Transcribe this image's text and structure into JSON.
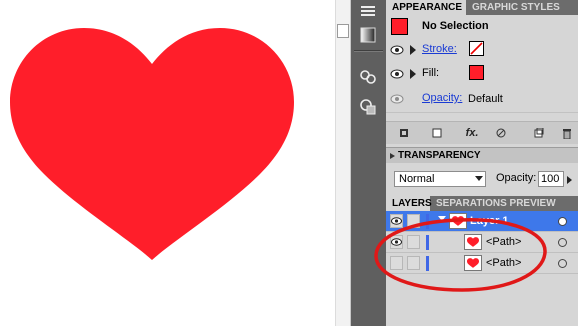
{
  "appearance": {
    "tabs": [
      "APPEARANCE",
      "GRAPHIC STYLES"
    ],
    "selection_label": "No Selection",
    "stroke_label": "Stroke:",
    "fill_label": "Fill:",
    "opacity_label": "Opacity:",
    "opacity_value": "Default",
    "fx_label": "fx."
  },
  "transparency": {
    "title": "TRANSPARENCY",
    "blend_mode": "Normal",
    "opacity_label": "Opacity:",
    "opacity_value": "100"
  },
  "layers": {
    "tabs": [
      "LAYERS",
      "SEPARATIONS PREVIEW"
    ],
    "rows": [
      {
        "label": "Layer 1"
      },
      {
        "label": "<Path>"
      },
      {
        "label": "<Path>"
      }
    ]
  },
  "colors": {
    "heart": "#ff1e2a",
    "selection_blue": "#3e78ea",
    "annotation": "#e01818",
    "panel_gray": "#d6d6d6"
  }
}
